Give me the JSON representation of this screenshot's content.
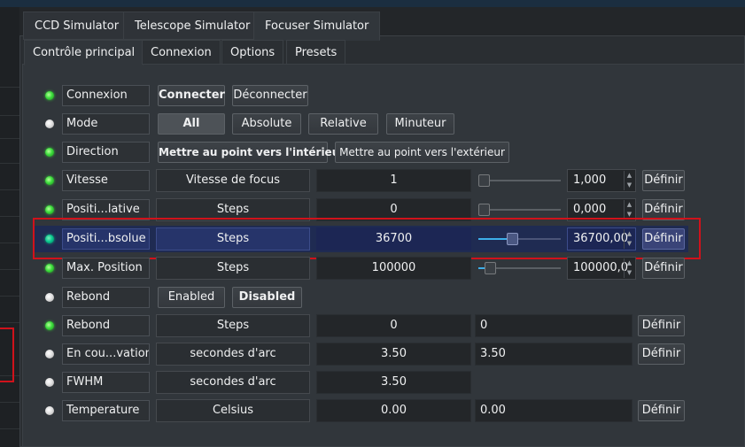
{
  "tabs": [
    {
      "label": "CCD Simulator"
    },
    {
      "label": "Telescope Simulator"
    },
    {
      "label": "Focuser Simulator"
    }
  ],
  "subtabs": [
    {
      "label": "Contrôle principal"
    },
    {
      "label": "Connexion"
    },
    {
      "label": "Options"
    },
    {
      "label": "Presets"
    }
  ],
  "rows": {
    "connexion": {
      "label": "Connexion",
      "connect": "Connecter",
      "disconnect": "Déconnecter",
      "led": "green"
    },
    "mode": {
      "label": "Mode",
      "all": "All",
      "absolute": "Absolute",
      "relative": "Relative",
      "timer": "Minuteur",
      "led": "grey"
    },
    "direction": {
      "label": "Direction",
      "inward": "Mettre au point vers l'intérieur",
      "outward": "Mettre au point vers l'extérieur",
      "led": "green"
    },
    "speed": {
      "label": "Vitesse",
      "name": "Vitesse de focus",
      "value": "1",
      "spin": "1,000",
      "set": "Définir",
      "led": "green"
    },
    "relpos": {
      "label": "Positi...lative",
      "name": "Steps",
      "value": "0",
      "spin": "0,000",
      "set": "Définir",
      "led": "green"
    },
    "abspos": {
      "label": "Positi...bsolue",
      "name": "Steps",
      "value": "36700",
      "spin": "36700,00",
      "set": "Définir",
      "led": "green"
    },
    "maxpos": {
      "label": "Max. Position",
      "name": "Steps",
      "value": "100000",
      "spin": "100000,0",
      "set": "Définir",
      "led": "green"
    },
    "backlash_toggle": {
      "label": "Rebond",
      "enabled": "Enabled",
      "disabled": "Disabled",
      "led": "grey"
    },
    "backlash": {
      "label": "Rebond",
      "name": "Steps",
      "value": "0",
      "input": "0",
      "set": "Définir",
      "led": "green"
    },
    "seeing": {
      "label": "En cou...vation",
      "name": "secondes d'arc",
      "value": "3.50",
      "input": "3.50",
      "set": "Définir",
      "led": "grey"
    },
    "fwhm": {
      "label": "FWHM",
      "name": "secondes d'arc",
      "value": "3.50",
      "led": "grey"
    },
    "temperature": {
      "label": "Temperature",
      "name": "Celsius",
      "value": "0.00",
      "input": "0.00",
      "set": "Définir",
      "led": "grey"
    }
  },
  "slider_levels": {
    "speed": 0.0,
    "relpos": 0.0,
    "abspos": 0.367,
    "maxpos": 0.0
  },
  "colors": {
    "led_ok": "#3cdc3c",
    "led_idle": "#dcdcdc",
    "highlight": "#1f2b52",
    "annotation": "#d0121b"
  }
}
